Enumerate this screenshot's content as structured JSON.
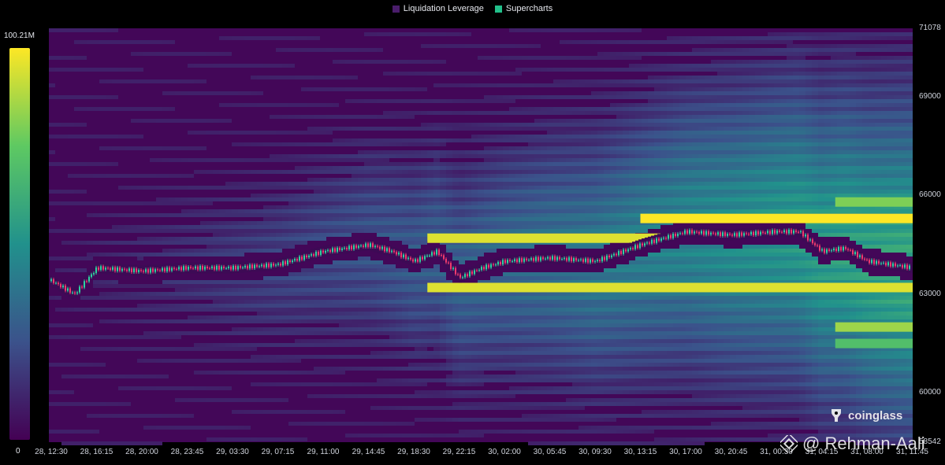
{
  "legend": [
    {
      "label": "Liquidation Leverage",
      "color": "#4a1d6b"
    },
    {
      "label": "Supercharts",
      "color": "#22c08a"
    }
  ],
  "colorbar": {
    "max_label": "100.21M",
    "min_label": "0"
  },
  "brand": {
    "name": "coinglass",
    "icon": "coinglass-logo-icon"
  },
  "watermark": {
    "text": "@ Rehman-Aali",
    "icon": "binance-logo-icon"
  },
  "chart_data": {
    "type": "heatmap",
    "title": "",
    "xlabel": "",
    "ylabel": "",
    "colorscale": [
      "#440154",
      "#3b528b",
      "#21918c",
      "#5ec962",
      "#fde725"
    ],
    "color_range": [
      0,
      100.21
    ],
    "color_unit": "M",
    "ylim": [
      58500,
      71078
    ],
    "y_ticks": [
      71078,
      69000,
      66000,
      63000,
      60000
    ],
    "y_tick_labels": [
      "71078",
      "69000",
      "66000",
      "63000",
      "60000"
    ],
    "y_bottom_label": "58542",
    "x_tick_labels": [
      "28, 12:30",
      "28, 16:15",
      "28, 20:00",
      "28, 23:45",
      "29, 03:30",
      "29, 07:15",
      "29, 11:00",
      "29, 14:45",
      "29, 18:30",
      "29, 22:15",
      "30, 02:00",
      "30, 05:45",
      "30, 09:30",
      "30, 13:15",
      "30, 17:00",
      "30, 20:45",
      "31, 00:30",
      "31, 04:15",
      "31, 08:00",
      "31, 11:45"
    ],
    "price_series": {
      "name": "Price",
      "x_index": [
        0,
        0.5,
        1,
        2,
        3,
        4,
        5,
        6,
        7,
        7.5,
        8,
        8.5,
        9,
        9.5,
        10,
        11,
        12,
        13,
        14,
        15,
        16,
        16.5,
        17,
        17.5,
        18,
        19
      ],
      "values": [
        63400,
        63000,
        63800,
        63700,
        63800,
        63800,
        63900,
        64300,
        64500,
        64300,
        64000,
        64300,
        63500,
        63800,
        64000,
        64100,
        64000,
        64500,
        64900,
        64800,
        64900,
        64900,
        64300,
        64400,
        64000,
        63800
      ]
    },
    "bands": [
      {
        "price": 64700,
        "start_index": 8.3,
        "end_index": 13.5,
        "intensity": 95
      },
      {
        "price": 65300,
        "start_index": 13.0,
        "end_index": 19.4,
        "intensity": 100
      },
      {
        "price": 63200,
        "start_index": 8.3,
        "end_index": 19.4,
        "intensity": 95
      },
      {
        "price": 65800,
        "start_index": 17.3,
        "end_index": 19.4,
        "intensity": 80
      },
      {
        "price": 62000,
        "start_index": 17.3,
        "end_index": 19.4,
        "intensity": 85
      },
      {
        "price": 61500,
        "start_index": 17.3,
        "end_index": 19.4,
        "intensity": 70
      }
    ]
  }
}
